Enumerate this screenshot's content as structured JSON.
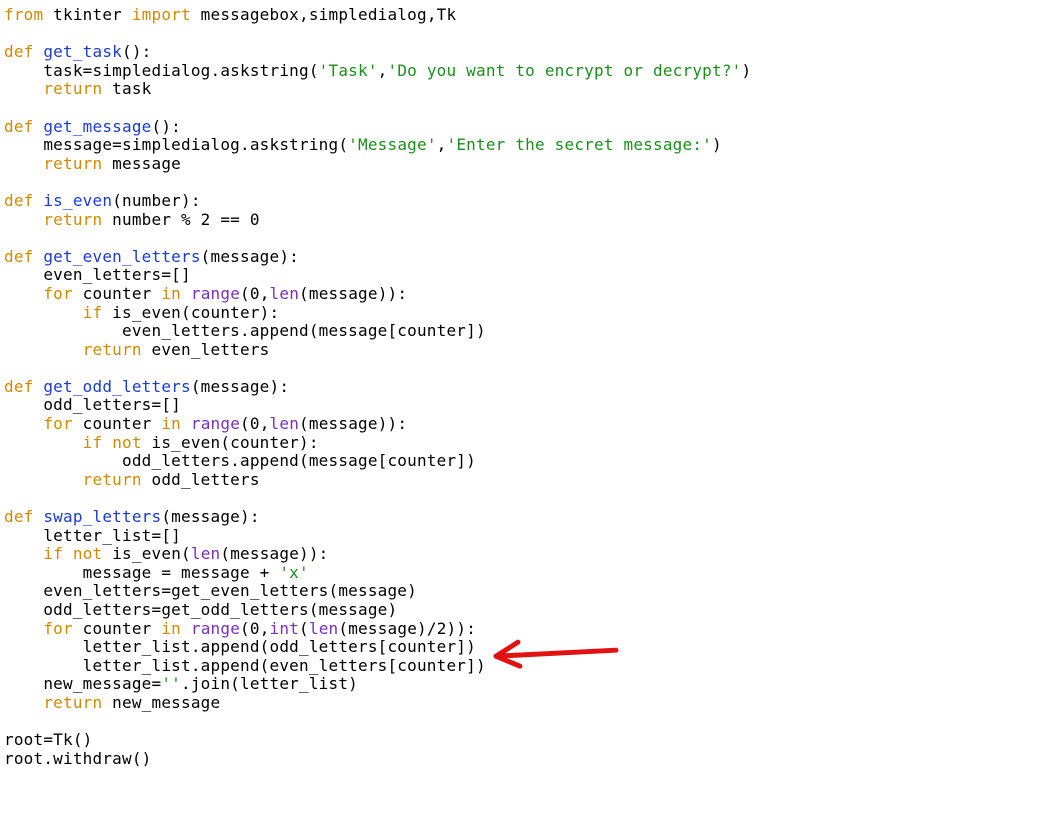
{
  "code": {
    "tokens": [
      [
        {
          "t": "kw",
          "v": "from"
        },
        {
          "t": "id",
          "v": " tkinter "
        },
        {
          "t": "kw",
          "v": "import"
        },
        {
          "t": "id",
          "v": " messagebox,simpledialog,Tk"
        }
      ],
      [],
      [
        {
          "t": "kw",
          "v": "def"
        },
        {
          "t": "id",
          "v": " "
        },
        {
          "t": "fn",
          "v": "get_task"
        },
        {
          "t": "id",
          "v": "():"
        }
      ],
      [
        {
          "t": "id",
          "v": "    task=simpledialog.askstring("
        },
        {
          "t": "str",
          "v": "'Task'"
        },
        {
          "t": "id",
          "v": ","
        },
        {
          "t": "str",
          "v": "'Do you want to encrypt or decrypt?'"
        },
        {
          "t": "id",
          "v": ")"
        }
      ],
      [
        {
          "t": "id",
          "v": "    "
        },
        {
          "t": "kw",
          "v": "return"
        },
        {
          "t": "id",
          "v": " task"
        }
      ],
      [],
      [
        {
          "t": "kw",
          "v": "def"
        },
        {
          "t": "id",
          "v": " "
        },
        {
          "t": "fn",
          "v": "get_message"
        },
        {
          "t": "id",
          "v": "():"
        }
      ],
      [
        {
          "t": "id",
          "v": "    message=simpledialog.askstring("
        },
        {
          "t": "str",
          "v": "'Message'"
        },
        {
          "t": "id",
          "v": ","
        },
        {
          "t": "str",
          "v": "'Enter the secret message:'"
        },
        {
          "t": "id",
          "v": ")"
        }
      ],
      [
        {
          "t": "id",
          "v": "    "
        },
        {
          "t": "kw",
          "v": "return"
        },
        {
          "t": "id",
          "v": " message"
        }
      ],
      [],
      [
        {
          "t": "kw",
          "v": "def"
        },
        {
          "t": "id",
          "v": " "
        },
        {
          "t": "fn",
          "v": "is_even"
        },
        {
          "t": "id",
          "v": "(number):"
        }
      ],
      [
        {
          "t": "id",
          "v": "    "
        },
        {
          "t": "kw",
          "v": "return"
        },
        {
          "t": "id",
          "v": " number % 2 == 0"
        }
      ],
      [],
      [
        {
          "t": "kw",
          "v": "def"
        },
        {
          "t": "id",
          "v": " "
        },
        {
          "t": "fn",
          "v": "get_even_letters"
        },
        {
          "t": "id",
          "v": "(message):"
        }
      ],
      [
        {
          "t": "id",
          "v": "    even_letters=[]"
        }
      ],
      [
        {
          "t": "id",
          "v": "    "
        },
        {
          "t": "kw",
          "v": "for"
        },
        {
          "t": "id",
          "v": " counter "
        },
        {
          "t": "kw",
          "v": "in"
        },
        {
          "t": "id",
          "v": " "
        },
        {
          "t": "builtin",
          "v": "range"
        },
        {
          "t": "id",
          "v": "(0,"
        },
        {
          "t": "builtin",
          "v": "len"
        },
        {
          "t": "id",
          "v": "(message)):"
        }
      ],
      [
        {
          "t": "id",
          "v": "        "
        },
        {
          "t": "kw",
          "v": "if"
        },
        {
          "t": "id",
          "v": " is_even(counter):"
        }
      ],
      [
        {
          "t": "id",
          "v": "            even_letters.append(message[counter])"
        }
      ],
      [
        {
          "t": "id",
          "v": "        "
        },
        {
          "t": "kw",
          "v": "return"
        },
        {
          "t": "id",
          "v": " even_letters"
        }
      ],
      [],
      [
        {
          "t": "kw",
          "v": "def"
        },
        {
          "t": "id",
          "v": " "
        },
        {
          "t": "fn",
          "v": "get_odd_letters"
        },
        {
          "t": "id",
          "v": "(message):"
        }
      ],
      [
        {
          "t": "id",
          "v": "    odd_letters=[]"
        }
      ],
      [
        {
          "t": "id",
          "v": "    "
        },
        {
          "t": "kw",
          "v": "for"
        },
        {
          "t": "id",
          "v": " counter "
        },
        {
          "t": "kw",
          "v": "in"
        },
        {
          "t": "id",
          "v": " "
        },
        {
          "t": "builtin",
          "v": "range"
        },
        {
          "t": "id",
          "v": "(0,"
        },
        {
          "t": "builtin",
          "v": "len"
        },
        {
          "t": "id",
          "v": "(message)):"
        }
      ],
      [
        {
          "t": "id",
          "v": "        "
        },
        {
          "t": "kw",
          "v": "if"
        },
        {
          "t": "id",
          "v": " "
        },
        {
          "t": "kw",
          "v": "not"
        },
        {
          "t": "id",
          "v": " is_even(counter):"
        }
      ],
      [
        {
          "t": "id",
          "v": "            odd_letters.append(message[counter])"
        }
      ],
      [
        {
          "t": "id",
          "v": "        "
        },
        {
          "t": "kw",
          "v": "return"
        },
        {
          "t": "id",
          "v": " odd_letters"
        }
      ],
      [],
      [
        {
          "t": "kw",
          "v": "def"
        },
        {
          "t": "id",
          "v": " "
        },
        {
          "t": "fn",
          "v": "swap_letters"
        },
        {
          "t": "id",
          "v": "(message):"
        }
      ],
      [
        {
          "t": "id",
          "v": "    letter_list=[]"
        }
      ],
      [
        {
          "t": "id",
          "v": "    "
        },
        {
          "t": "kw",
          "v": "if"
        },
        {
          "t": "id",
          "v": " "
        },
        {
          "t": "kw",
          "v": "not"
        },
        {
          "t": "id",
          "v": " is_even("
        },
        {
          "t": "builtin",
          "v": "len"
        },
        {
          "t": "id",
          "v": "(message)):"
        }
      ],
      [
        {
          "t": "id",
          "v": "        message = message + "
        },
        {
          "t": "str",
          "v": "'x'"
        }
      ],
      [
        {
          "t": "id",
          "v": "    even_letters=get_even_letters(message)"
        }
      ],
      [
        {
          "t": "id",
          "v": "    odd_letters=get_odd_letters(message)"
        }
      ],
      [
        {
          "t": "id",
          "v": "    "
        },
        {
          "t": "kw",
          "v": "for"
        },
        {
          "t": "id",
          "v": " counter "
        },
        {
          "t": "kw",
          "v": "in"
        },
        {
          "t": "id",
          "v": " "
        },
        {
          "t": "builtin",
          "v": "range"
        },
        {
          "t": "id",
          "v": "(0,"
        },
        {
          "t": "builtin",
          "v": "int"
        },
        {
          "t": "id",
          "v": "("
        },
        {
          "t": "builtin",
          "v": "len"
        },
        {
          "t": "id",
          "v": "(message)/2)):"
        }
      ],
      [
        {
          "t": "id",
          "v": "        letter_list.append(odd_letters[counter])"
        }
      ],
      [
        {
          "t": "id",
          "v": "        letter_list.append(even_letters[counter])"
        }
      ],
      [
        {
          "t": "id",
          "v": "    new_message="
        },
        {
          "t": "str",
          "v": "''"
        },
        {
          "t": "id",
          "v": ".join(letter_list)"
        }
      ],
      [
        {
          "t": "id",
          "v": "    "
        },
        {
          "t": "kw",
          "v": "return"
        },
        {
          "t": "id",
          "v": " new_message"
        }
      ],
      [],
      [
        {
          "t": "id",
          "v": "root=Tk()"
        }
      ],
      [
        {
          "t": "id",
          "v": "root.withdraw()"
        }
      ]
    ]
  },
  "annotation": {
    "arrow_color": "#e21212",
    "arrow_target_line": 34
  }
}
